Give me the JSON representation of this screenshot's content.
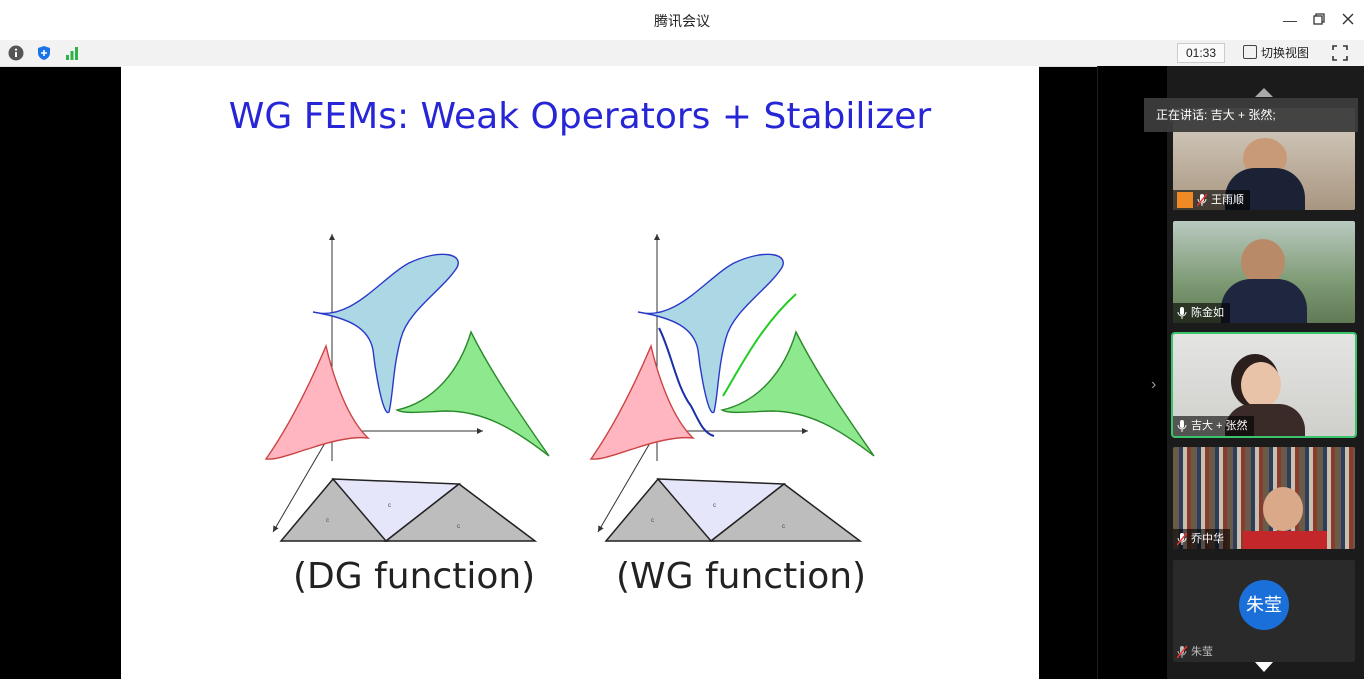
{
  "window": {
    "title": "腾讯会议"
  },
  "toolbar": {
    "timer": "01:33",
    "switch_view_label": "切换视图"
  },
  "slide": {
    "title": "WG FEMs: Weak Operators + Stabilizer",
    "left_caption": "(DG function)",
    "right_caption": "(WG function)"
  },
  "sidebar": {
    "speaking_label": "正在讲话: 吉大 + 张然;",
    "participants": [
      {
        "name": "王雨顺"
      },
      {
        "name": "陈金如"
      },
      {
        "name": "吉大 + 张然"
      },
      {
        "name": "乔中华"
      },
      {
        "name": "朱莹",
        "avatar_text": "朱莹"
      }
    ]
  },
  "colors": {
    "accent_green": "#3cc46a",
    "title_blue": "#2626d6",
    "avatar_blue": "#1a6fd8"
  }
}
